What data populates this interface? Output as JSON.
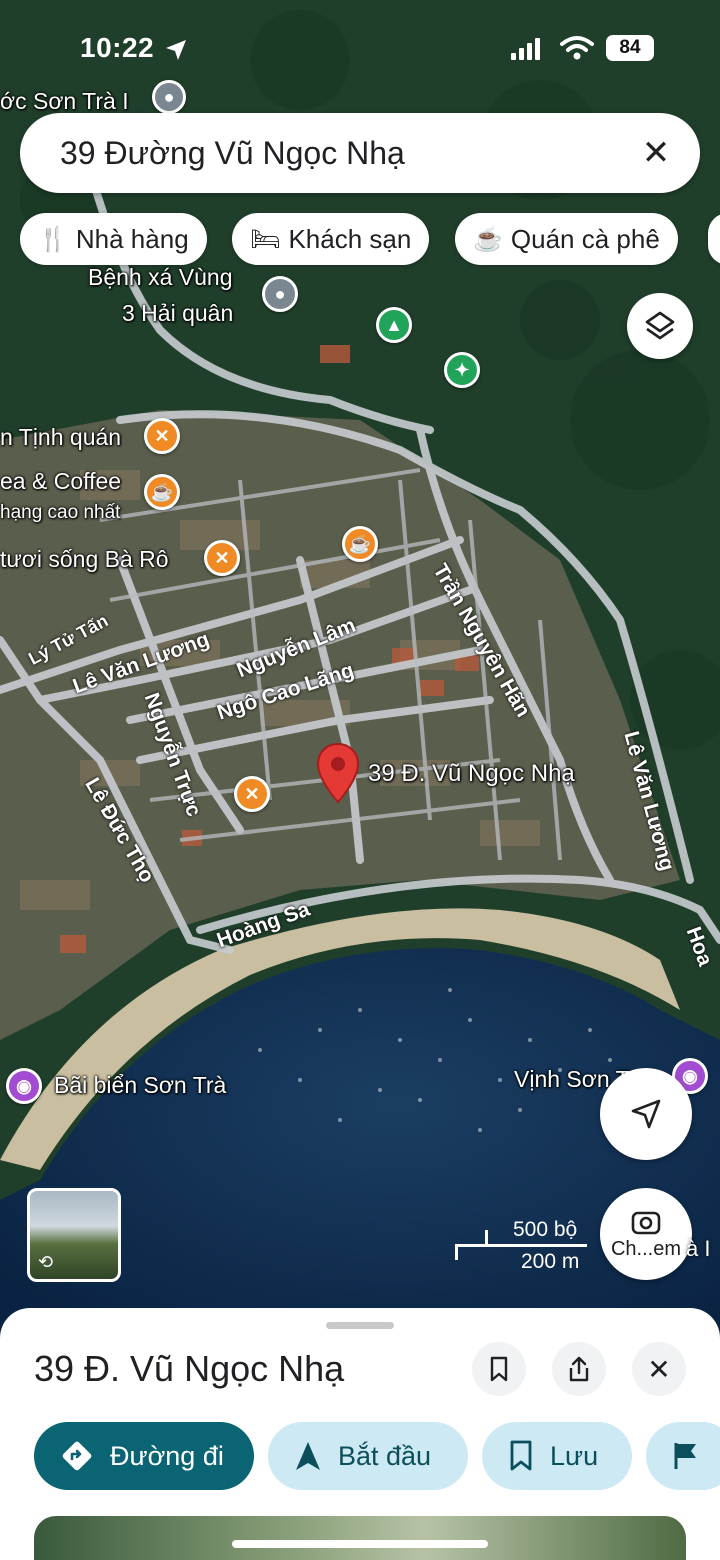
{
  "status": {
    "time": "10:22",
    "battery": "84"
  },
  "search": {
    "query": "39 Đường Vũ Ngọc Nhạ"
  },
  "chips": [
    {
      "icon": "fork-knife-icon",
      "label": "Nhà hàng"
    },
    {
      "icon": "bed-icon",
      "label": "Khách sạn"
    },
    {
      "icon": "coffee-cup-icon",
      "label": "Quán cà phê"
    }
  ],
  "map": {
    "places": [
      {
        "label": "ớc Sơn Trà I"
      },
      {
        "label": "Bệnh xá Vùng"
      },
      {
        "label": "3 Hải quân"
      },
      {
        "label": "n Tịnh quán"
      },
      {
        "label": "ea & Coffee"
      },
      {
        "label": "hạng cao nhất"
      },
      {
        "label": "tươi sống Bà Rô"
      },
      {
        "label": "39 Đ. Vũ Ngọc Nhạ"
      },
      {
        "label": "Bãi biển Sơn Trà"
      },
      {
        "label": "Vịnh Sơn T"
      }
    ],
    "roads": [
      "Lý Tử Tấn",
      "Lê Văn Lương",
      "Nguyễn Lâm",
      "Ngô Cao Lãng",
      "Nguyễn Trực",
      "Trần Nguyên Hãn",
      "Lê Văn Lương",
      "Lê Đức Thọ",
      "Hoàng Sa",
      "Hoa"
    ],
    "scale": {
      "imperial": "500 bộ",
      "metric": "200 m"
    },
    "camera_label": "Ch...em",
    "cut_label": "à I"
  },
  "sheet": {
    "title": "39 Đ. Vũ Ngọc Nhạ",
    "actions": [
      {
        "icon": "directions-icon",
        "label": "Đường đi"
      },
      {
        "icon": "navigation-arrow-icon",
        "label": "Bắt đầu"
      },
      {
        "icon": "bookmark-icon",
        "label": "Lưu"
      }
    ]
  },
  "colors": {
    "primary": "#0b6473",
    "secondary": "#cde9f4",
    "pin": "#e53935",
    "restaurant": "#f08a24"
  }
}
